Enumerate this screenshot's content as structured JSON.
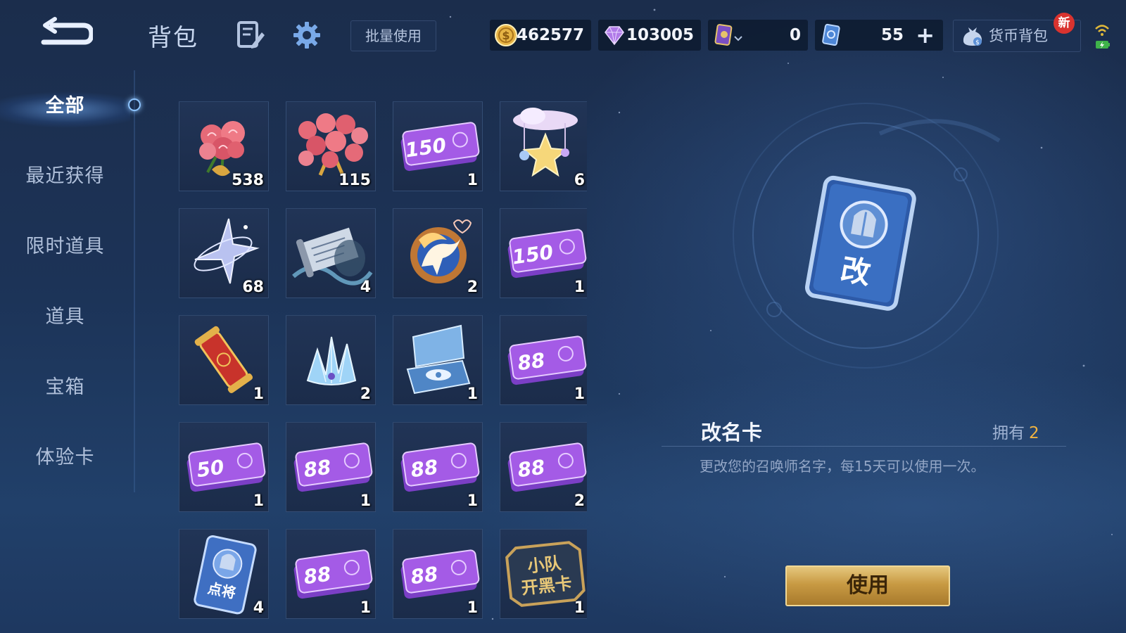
{
  "topbar": {
    "title": "背包",
    "batch_use_label": "批量使用",
    "currencies": [
      {
        "name": "gold-coin",
        "icon": "gold-coin-icon",
        "value": "462577"
      },
      {
        "name": "diamond",
        "icon": "diamond-icon",
        "value": "103005"
      },
      {
        "name": "card-ticket",
        "icon": "card-ticket-icon",
        "value": "0"
      },
      {
        "name": "blue-voucher",
        "icon": "blue-voucher-icon",
        "value": "55"
      }
    ],
    "add_symbol": "+",
    "wallet_label": "货币背包",
    "new_badge": "新"
  },
  "sidebar": {
    "items": [
      {
        "label": "全部",
        "active": true
      },
      {
        "label": "最近获得",
        "active": false
      },
      {
        "label": "限时道具",
        "active": false
      },
      {
        "label": "道具",
        "active": false
      },
      {
        "label": "宝箱",
        "active": false
      },
      {
        "label": "体验卡",
        "active": false
      }
    ]
  },
  "inventory": [
    {
      "icon": "rose-bouquet-small-icon",
      "count": "538"
    },
    {
      "icon": "rose-bouquet-large-icon",
      "count": "115"
    },
    {
      "icon": "ticket-150-icon",
      "count": "1",
      "text": "150"
    },
    {
      "icon": "star-cloud-charm-icon",
      "count": "6"
    },
    {
      "icon": "crystal-star-icon",
      "count": "68"
    },
    {
      "icon": "scroll-icon",
      "count": "4"
    },
    {
      "icon": "pegasus-emblem-icon",
      "count": "2"
    },
    {
      "icon": "ticket-150-icon",
      "count": "1",
      "text": "150"
    },
    {
      "icon": "red-scroll-icon",
      "count": "1"
    },
    {
      "icon": "ice-crystal-icon",
      "count": "2"
    },
    {
      "icon": "jewelry-box-icon",
      "count": "1"
    },
    {
      "icon": "ticket-88-icon",
      "count": "1",
      "text": "88"
    },
    {
      "icon": "ticket-50-icon",
      "count": "1",
      "text": "50"
    },
    {
      "icon": "ticket-88-icon",
      "count": "1",
      "text": "88"
    },
    {
      "icon": "ticket-88-icon",
      "count": "1",
      "text": "88"
    },
    {
      "icon": "ticket-88-icon",
      "count": "2",
      "text": "88"
    },
    {
      "icon": "hero-pick-card-icon",
      "count": "4",
      "text": "点将"
    },
    {
      "icon": "ticket-88-icon",
      "count": "1",
      "text": "88"
    },
    {
      "icon": "ticket-88-icon",
      "count": "1",
      "text": "88"
    },
    {
      "icon": "squad-card-icon",
      "count": "1",
      "text_lines": [
        "小队",
        "开黑卡"
      ]
    }
  ],
  "detail": {
    "card_glyph": "改",
    "name": "改名卡",
    "own_label": "拥有",
    "own_count": "2",
    "description": "更改您的召唤师名字，每15天可以使用一次。",
    "use_label": "使用"
  }
}
